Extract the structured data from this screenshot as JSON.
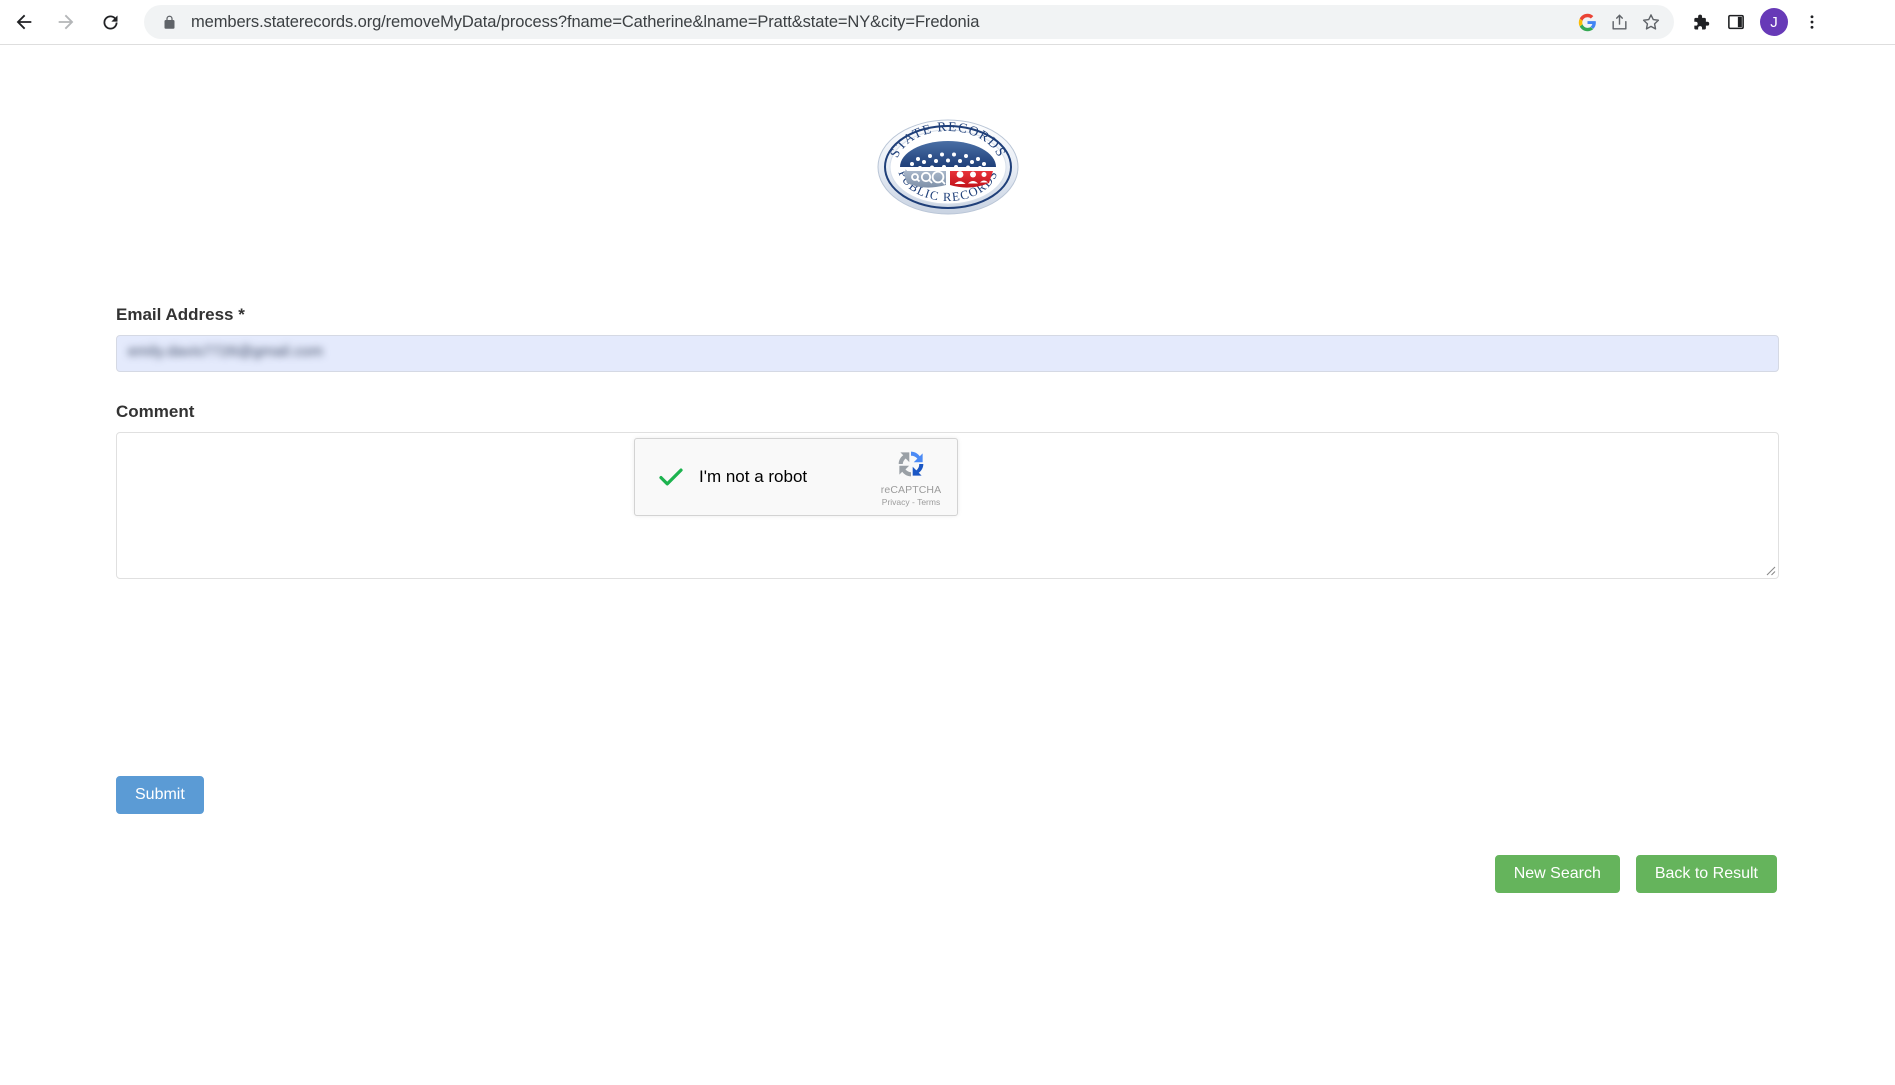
{
  "browser": {
    "url": "members.staterecords.org/removeMyData/process?fname=Catherine&lname=Pratt&state=NY&city=Fredonia",
    "back_icon": "back-arrow-icon",
    "forward_icon": "forward-arrow-icon",
    "reload_icon": "reload-icon",
    "lock_icon": "lock-icon",
    "google_icon": "google-g-icon",
    "share_icon": "share-icon",
    "bookmark_icon": "star-bookmark-icon",
    "extensions_icon": "puzzle-piece-icon",
    "side_panel_icon": "side-panel-icon",
    "menu_icon": "three-dot-menu-icon",
    "avatar_initial": "J",
    "avatar_color": "#673ab7"
  },
  "site": {
    "logo_top_text": "STATE RECORDS",
    "logo_bottom_text": "PUBLIC RECORDS",
    "logo_alt": "state-records-public-records-seal"
  },
  "form": {
    "email": {
      "label": "Email Address",
      "required_marker": "*",
      "value": "emily.davis7726@gmail.com",
      "placeholder": "",
      "autofill_background": "#e4eafc",
      "redacted": true
    },
    "comment": {
      "label": "Comment",
      "value": "",
      "placeholder": ""
    },
    "submit_label": "Submit",
    "submit_color": "#5b9bd5"
  },
  "recaptcha": {
    "checkbox_state": "checked",
    "checkmark_color": "#1db34f",
    "label": "I'm not a robot",
    "brand_name": "reCAPTCHA",
    "privacy_label": "Privacy",
    "separator": "-",
    "terms_label": "Terms",
    "legal": "Privacy - Terms"
  },
  "actions": {
    "new_search_label": "New Search",
    "back_to_result_label": "Back to Result",
    "green_color": "#65b45c"
  }
}
